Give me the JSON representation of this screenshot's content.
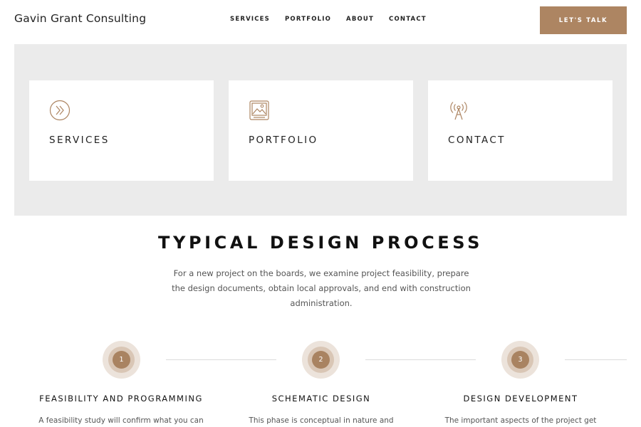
{
  "header": {
    "brand": "Gavin Grant Consulting",
    "nav": [
      "SERVICES",
      "PORTFOLIO",
      "ABOUT",
      "CONTACT"
    ],
    "cta": "LET'S TALK"
  },
  "cards": [
    {
      "label": "SERVICES",
      "icon": "double-chevron-right-icon"
    },
    {
      "label": "PORTFOLIO",
      "icon": "image-gallery-icon"
    },
    {
      "label": "CONTACT",
      "icon": "broadcast-tower-icon"
    }
  ],
  "process": {
    "title": "TYPICAL DESIGN PROCESS",
    "intro": "For a new project on the boards, we examine project feasibility, prepare the design documents, obtain local approvals, and end with construction administration.",
    "steps": [
      {
        "number": "1",
        "title": "FEASIBILITY AND PROGRAMMING",
        "text": "A feasibility study will confirm what you can"
      },
      {
        "number": "2",
        "title": "SCHEMATIC DESIGN",
        "text": "This phase is conceptual in nature and"
      },
      {
        "number": "3",
        "title": "DESIGN DEVELOPMENT",
        "text": "The important aspects of the project get"
      }
    ]
  },
  "colors": {
    "accent": "#ad8562",
    "band": "#ebebeb"
  }
}
